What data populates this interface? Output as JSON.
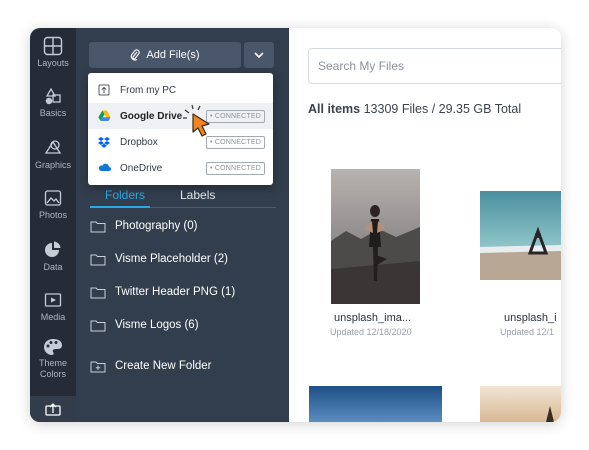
{
  "rail": {
    "items": [
      {
        "label": "Layouts",
        "icon": "layouts-icon"
      },
      {
        "label": "Basics",
        "icon": "basics-icon"
      },
      {
        "label": "Graphics",
        "icon": "graphics-icon"
      },
      {
        "label": "Photos",
        "icon": "photos-icon"
      },
      {
        "label": "Data",
        "icon": "data-icon"
      },
      {
        "label": "Media",
        "icon": "media-icon"
      },
      {
        "label": "Theme Colors",
        "icon": "palette-icon"
      }
    ],
    "upload_icon": "upload-icon"
  },
  "panel": {
    "add_button_label": "Add File(s)",
    "tabs": [
      {
        "label": "Folders"
      },
      {
        "label": "Labels"
      }
    ],
    "folders": [
      {
        "label": "Photography (0)"
      },
      {
        "label": "Visme Placeholder (2)"
      },
      {
        "label": "Twitter Header PNG (1)"
      },
      {
        "label": "Visme Logos (6)"
      }
    ],
    "create_folder_label": "Create New Folder"
  },
  "dropdown": {
    "items": [
      {
        "label": "From my PC",
        "icon": "upload-pc-icon",
        "badge": ""
      },
      {
        "label": "Google Drive",
        "icon": "google-drive-icon",
        "badge": "• CONNECTED"
      },
      {
        "label": "Dropbox",
        "icon": "dropbox-icon",
        "badge": "• CONNECTED"
      },
      {
        "label": "OneDrive",
        "icon": "onedrive-icon",
        "badge": "• CONNECTED"
      }
    ],
    "highlighted": "Google Drive"
  },
  "main": {
    "search_placeholder": "Search My Files",
    "summary_bold": "All items",
    "summary_rest": "13309 Files / 29.35 GB Total",
    "files": [
      {
        "name": "unsplash_ima...",
        "date": "Updated 12/18/2020"
      },
      {
        "name": "unsplash_i",
        "date": "Updated 12/1"
      }
    ]
  },
  "colors": {
    "rail_bg": "#252c38",
    "panel_bg": "#323d4d",
    "accent": "#29a9e6",
    "cursor": "#f0841f"
  }
}
